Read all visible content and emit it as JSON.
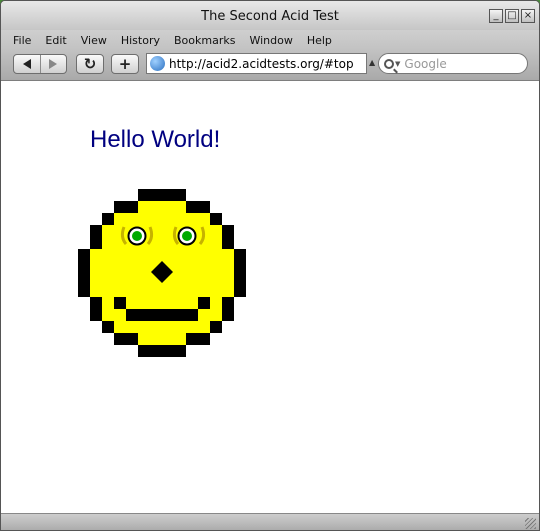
{
  "window": {
    "title": "The Second Acid Test"
  },
  "window_controls": {
    "minimize": "_",
    "maximize": "□",
    "close": "×"
  },
  "menu": [
    "File",
    "Edit",
    "View",
    "History",
    "Bookmarks",
    "Window",
    "Help"
  ],
  "toolbar": {
    "reload_glyph": "↻",
    "add_glyph": "+",
    "url": "http://acid2.acidtests.org/#top",
    "search_placeholder": "Google"
  },
  "page": {
    "heading": "Hello World!"
  },
  "colors": {
    "face": "#ffff00",
    "outline": "#000000",
    "eye": "#00aa00",
    "heading": "#000080"
  }
}
